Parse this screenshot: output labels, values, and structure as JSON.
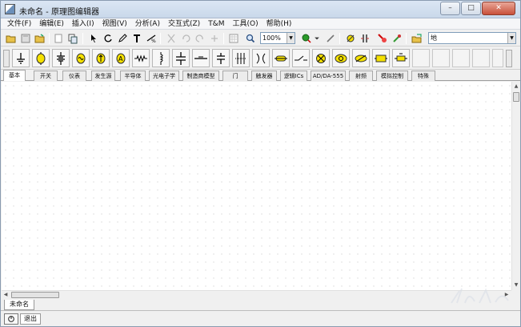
{
  "title": {
    "text": "未命名 - 原理图编辑器",
    "minimize": "–",
    "maximize": "□",
    "close": "✕"
  },
  "menu": [
    "文件(F)",
    "编辑(E)",
    "插入(I)",
    "视图(V)",
    "分析(A)",
    "交互式(Z)",
    "T&M",
    "工具(O)",
    "帮助(H)"
  ],
  "toolbar": {
    "zoom": "100%",
    "search_value": "地"
  },
  "tabs": [
    "基本",
    "开关",
    "仪表",
    "发生源",
    "半导体",
    "光电子学",
    "制造商模型",
    "门",
    "触发器",
    "逻辑ICs",
    "AD/DA-555",
    "射频",
    "模拟控制",
    "特殊"
  ],
  "sheet_tab": "未命名",
  "status": {
    "exit": "退出"
  },
  "colors": {
    "component_yellow": "#f5e100",
    "canvas": "#ffffff"
  }
}
